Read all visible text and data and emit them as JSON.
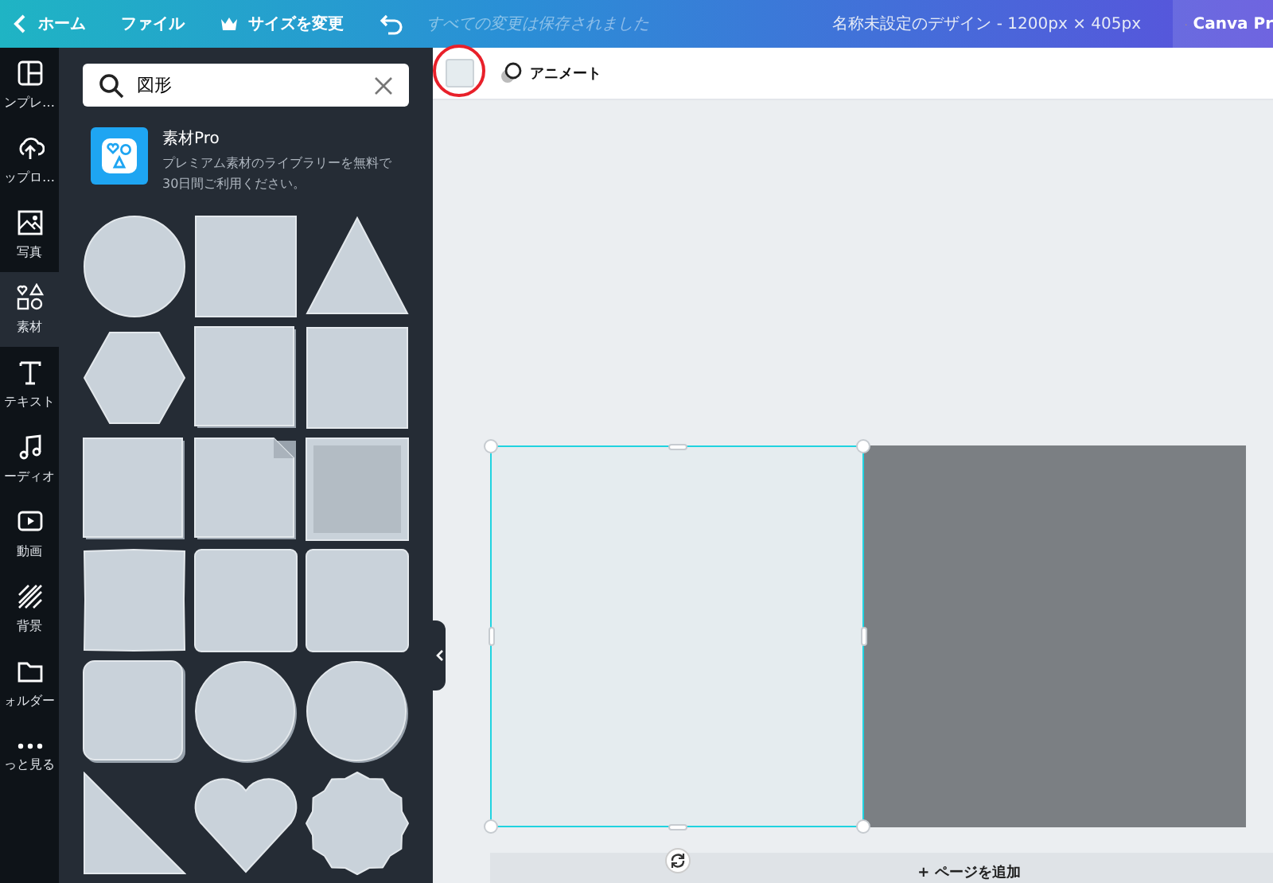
{
  "top_bar": {
    "home": "ホーム",
    "file": "ファイル",
    "resize": "サイズを変更",
    "save_status": "すべての変更は保存されました",
    "design_title": "名称未設定のデザイン - 1200px × 405px",
    "pro_button": "Canva Pr"
  },
  "rail": [
    {
      "label": "ンプレ…",
      "kind": "layout",
      "selected": false
    },
    {
      "label": "ップロ…",
      "kind": "upload",
      "selected": false
    },
    {
      "label": "写真",
      "kind": "photo",
      "selected": false
    },
    {
      "label": "素材",
      "kind": "elements",
      "selected": true
    },
    {
      "label": "テキスト",
      "kind": "text",
      "selected": false
    },
    {
      "label": "ーディオ",
      "kind": "music",
      "selected": false
    },
    {
      "label": "動画",
      "kind": "video",
      "selected": false
    },
    {
      "label": "背景",
      "kind": "stripes",
      "selected": false
    },
    {
      "label": "ォルダー",
      "kind": "folder",
      "selected": false
    },
    {
      "label": "っと見る",
      "kind": "more",
      "selected": false
    }
  ],
  "panel": {
    "search": {
      "value": "図形"
    },
    "promo": {
      "title": "素材Pro",
      "text": "プレミアム素材のライブラリーを無料で30日間ご利用ください。"
    },
    "shapes": [
      {
        "kind": "circle"
      },
      {
        "kind": "square"
      },
      {
        "kind": "triangle"
      },
      {
        "kind": "hexagon"
      },
      {
        "kind": "shadow-square"
      },
      {
        "kind": "square"
      },
      {
        "kind": "shadow-square"
      },
      {
        "kind": "folded-square"
      },
      {
        "kind": "framed-square"
      },
      {
        "kind": "rough-square"
      },
      {
        "kind": "rounded-square"
      },
      {
        "kind": "rounded-square"
      },
      {
        "kind": "shadow-rounded"
      },
      {
        "kind": "shadow-circle"
      },
      {
        "kind": "shadow-circle"
      },
      {
        "kind": "right-triangle"
      },
      {
        "kind": "heart"
      },
      {
        "kind": "scalloped"
      }
    ]
  },
  "toolbar": {
    "animate": "アニメート"
  },
  "canvas": {
    "add_page": "+ ページを追加"
  }
}
